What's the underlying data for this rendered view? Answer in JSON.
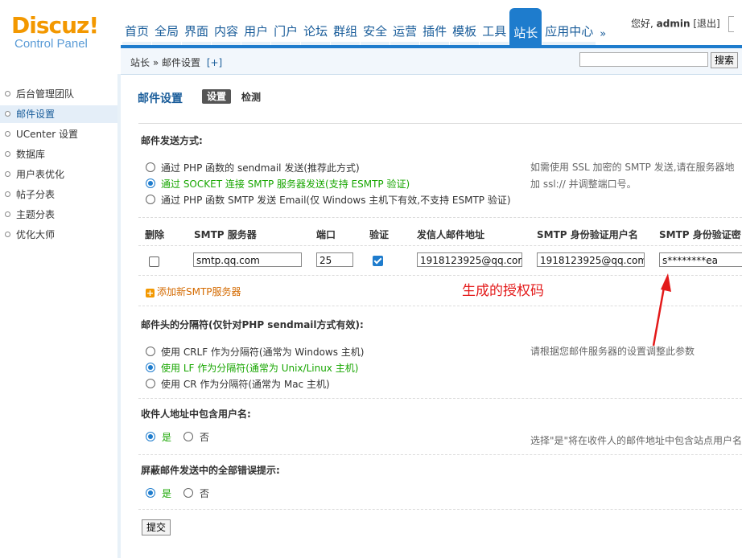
{
  "header": {
    "logo_brand": "Discuz!",
    "logo_sub": "Control Panel",
    "nav": [
      "首页",
      "全局",
      "界面",
      "内容",
      "用户",
      "门户",
      "论坛",
      "群组",
      "安全",
      "运营",
      "插件",
      "模板",
      "工具",
      "站长",
      "应用中心"
    ],
    "nav_active_index": 13,
    "more": "»",
    "greeting": "您好,",
    "username": "admin",
    "logout": "[退出]"
  },
  "breadcrumb": {
    "text": "站长 » 邮件设置",
    "plus": "[+]",
    "search_button": "搜索",
    "search_value": ""
  },
  "sidebar": {
    "items": [
      "后台管理团队",
      "邮件设置",
      "UCenter 设置",
      "数据库",
      "用户表优化",
      "帖子分表",
      "主题分表",
      "优化大师"
    ],
    "active_index": 1
  },
  "main": {
    "title": "邮件设置",
    "tabs": {
      "settings": "设置",
      "check": "检测"
    },
    "send_method": {
      "title": "邮件发送方式:",
      "options": [
        "通过 PHP 函数的 sendmail 发送(推荐此方式)",
        "通过 SOCKET 连接 SMTP 服务器发送(支持 ESMTP 验证)",
        "通过 PHP 函数 SMTP 发送 Email(仅 Windows 主机下有效,不支持 ESMTP 验证)"
      ],
      "selected_index": 1,
      "tip_line1": "如需使用 SSL 加密的 SMTP 发送,请在服务器地",
      "tip_line2": "加 ssl:// 并调整端口号。"
    },
    "smtp_table": {
      "headers": [
        "删除",
        "SMTP 服务器",
        "端口",
        "验证",
        "发信人邮件地址",
        "SMTP 身份验证用户名",
        "SMTP 身份验证密"
      ],
      "rows": [
        {
          "server": "smtp.qq.com",
          "port": "25",
          "auth": true,
          "from": "1918123925@qq.com",
          "user": "1918123925@qq.com",
          "password": "s********ea",
          "delete": false
        }
      ],
      "add_link": "添加新SMTP服务器"
    },
    "delimiter": {
      "title": "邮件头的分隔符(仅针对PHP sendmail方式有效):",
      "options": [
        "使用 CRLF 作为分隔符(通常为 Windows 主机)",
        "使用 LF 作为分隔符(通常为 Unix/Linux 主机)",
        "使用 CR 作为分隔符(通常为 Mac 主机)"
      ],
      "selected_index": 1,
      "tip": "请根据您邮件服务器的设置调整此参数"
    },
    "include_username": {
      "title": "收件人地址中包含用户名:",
      "yes": "是",
      "no": "否",
      "selected": "yes",
      "tip": "选择\"是\"将在收件人的邮件地址中包含站点用户名"
    },
    "silent": {
      "title": "屏蔽邮件发送中的全部错误提示:",
      "yes": "是",
      "no": "否",
      "selected": "yes"
    },
    "submit": "提交"
  },
  "annotation": {
    "text": "生成的授权码",
    "color": "#e31a1a"
  },
  "colors": {
    "accent": "#1e7ccd",
    "brand": "#f39800",
    "link": "#1a5d9a",
    "selected_option": "#17a600"
  }
}
